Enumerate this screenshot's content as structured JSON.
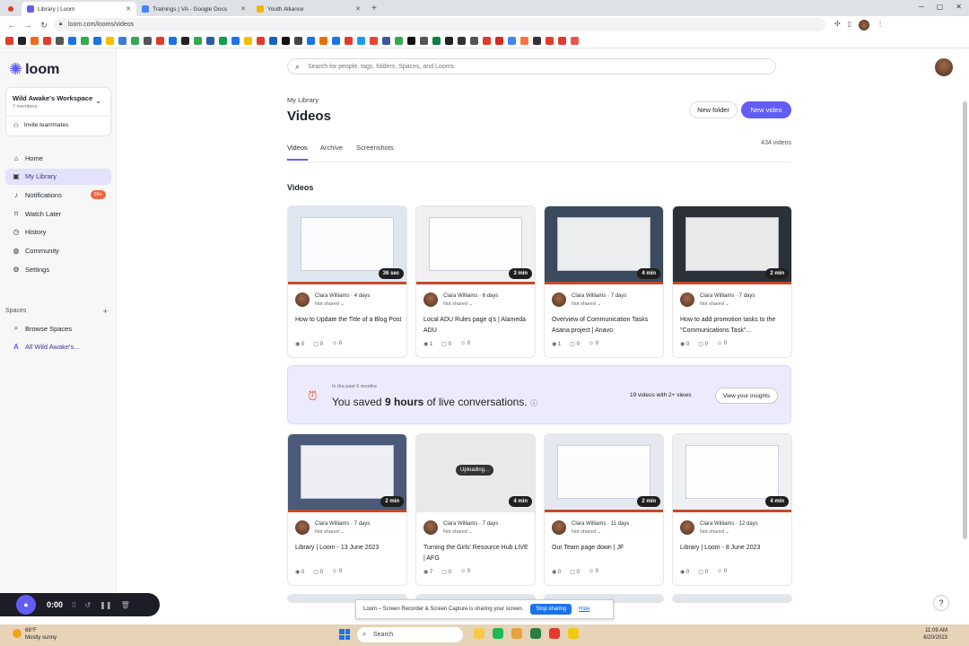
{
  "browser": {
    "tabs": [
      {
        "label": "Library | Loom",
        "active": true,
        "color": "#625df5"
      },
      {
        "label": "Trainings | VA - Google Docs",
        "active": false,
        "color": "#4285f4"
      },
      {
        "label": "Youth Alliance",
        "active": false,
        "color": "#f4b400"
      }
    ],
    "url": "loom.com/looms/videos",
    "bookmark_colors": [
      "#e23b2e",
      "#222",
      "#f26b1d",
      "#e23b2e",
      "#555",
      "#1a73e8",
      "#34a853",
      "#1a73e8",
      "#fbbc05",
      "#3d7dd8",
      "#34a853",
      "#555",
      "#e23b2e",
      "#1a73e8",
      "#222",
      "#34a853",
      "#2e5aa8",
      "#0f9d58",
      "#1a73e8",
      "#fbbc05",
      "#e23b2e",
      "#1565c0",
      "#111",
      "#444",
      "#1a73e8",
      "#e8710a",
      "#1a73e8",
      "#e23b2e",
      "#1d9bf0",
      "#ea4335",
      "#3b5998",
      "#34a853",
      "#111",
      "#555",
      "#0b8043",
      "#222",
      "#333",
      "#555",
      "#e23b2e",
      "#d62d20",
      "#4285f4",
      "#ff7043",
      "#333",
      "#e23b2e",
      "#e23b2e",
      "#ef5350"
    ]
  },
  "sidebar": {
    "brand": "loom",
    "workspace": {
      "name": "Wild Awake's Workspace",
      "members": "7 members",
      "invite": "Invite teammates"
    },
    "nav": [
      {
        "label": "Home",
        "icon": "home-icon",
        "glyph": "⌂"
      },
      {
        "label": "My Library",
        "icon": "library-icon",
        "glyph": "▣",
        "selected": true
      },
      {
        "label": "Notifications",
        "icon": "bell-icon",
        "glyph": "♪",
        "badge": "99+"
      },
      {
        "label": "Watch Later",
        "icon": "bookmark-icon",
        "glyph": "⌑"
      },
      {
        "label": "History",
        "icon": "history-icon",
        "glyph": "◷"
      },
      {
        "label": "Community",
        "icon": "globe-icon",
        "glyph": "◍"
      },
      {
        "label": "Settings",
        "icon": "gear-icon",
        "glyph": "⚙"
      }
    ],
    "spaces_heading": "Spaces",
    "spaces": [
      {
        "label": "Browse Spaces",
        "icon": "search-icon",
        "glyph": "⌕"
      },
      {
        "label": "All Wild Awake's...",
        "icon": "space-icon",
        "glyph": "A"
      }
    ]
  },
  "main": {
    "search_placeholder": "Search for people, tags, folders, Spaces, and Looms",
    "breadcrumb": "My Library",
    "title": "Videos",
    "new_folder": "New folder",
    "new_video": "New video",
    "tabs": [
      "Videos",
      "Archive",
      "Screenshots"
    ],
    "count": "434 videos",
    "section": "Videos"
  },
  "videos": [
    {
      "author": "Clara Williams",
      "age": "4 days",
      "share": "Not shared",
      "title": "How to Update the Title of a Blog Post",
      "duration": "36 sec",
      "views": "0",
      "comments": "0",
      "reactions": "0",
      "thumb": "#dfe6ef"
    },
    {
      "author": "Clara Williams",
      "age": "6 days",
      "share": "Not shared",
      "title": "Local ADU Rules page q's | Alameda ADU",
      "duration": "3 min",
      "views": "1",
      "comments": "0",
      "reactions": "0",
      "thumb": "#f0f0f0"
    },
    {
      "author": "Clara Williams",
      "age": "7 days",
      "share": "Not shared",
      "title": "Overview of Communication Tasks Asana project | Anavo",
      "duration": "4 min",
      "views": "1",
      "comments": "0",
      "reactions": "0",
      "thumb": "#3b4a5c"
    },
    {
      "author": "Clara Williams",
      "age": "7 days",
      "share": "Not shared",
      "title": "How to add promotion tasks to the \"Communications Task\"...",
      "duration": "2 min",
      "views": "0",
      "comments": "0",
      "reactions": "0",
      "thumb": "#2c3038"
    },
    {
      "author": "Clara Williams",
      "age": "7 days",
      "share": "Not shared",
      "title": "Library | Loom - 13 June 2023",
      "duration": "2 min",
      "views": "0",
      "comments": "0",
      "reactions": "0",
      "thumb": "#4b5a78"
    },
    {
      "author": "Clara Williams",
      "age": "7 days",
      "share": "Not shared",
      "title": "Turning the Girls' Resource Hub LIVE | AFG",
      "duration": "4 min",
      "views": "7",
      "comments": "0",
      "reactions": "0",
      "thumb": "#e9e9e9",
      "uploading": "Uploading..."
    },
    {
      "author": "Clara Williams",
      "age": "11 days",
      "share": "Not shared",
      "title": "Our Team page down | JF",
      "duration": "2 min",
      "views": "0",
      "comments": "0",
      "reactions": "0",
      "thumb": "#e6e8ef"
    },
    {
      "author": "Clara Williams",
      "age": "12 days",
      "share": "Not shared",
      "title": "Library | Loom - 8 June 2023",
      "duration": "4 min",
      "views": "0",
      "comments": "0",
      "reactions": "0",
      "thumb": "#eef0f3"
    }
  ],
  "insight": {
    "period": "In the past 6 months",
    "saved_prefix": "You saved ",
    "saved_hours": "9 hours",
    "saved_suffix": " of live conversations.",
    "views": "19 videos with 2+ views",
    "button": "View your insights"
  },
  "recorder": {
    "time": "0:00"
  },
  "sharebar": {
    "text": "Loom – Screen Recorder & Screen Capture is sharing your screen.",
    "stop": "Stop sharing",
    "hide": "Hide"
  },
  "taskbar": {
    "temp": "68°F",
    "weather": "Mostly sunny",
    "search": "Search",
    "time": "11:09 AM",
    "date": "6/20/2023",
    "app_colors": [
      "#f7c948",
      "#1db954",
      "#e8a33d",
      "#2d7d46",
      "#e23b2e",
      "#f2c811"
    ]
  }
}
